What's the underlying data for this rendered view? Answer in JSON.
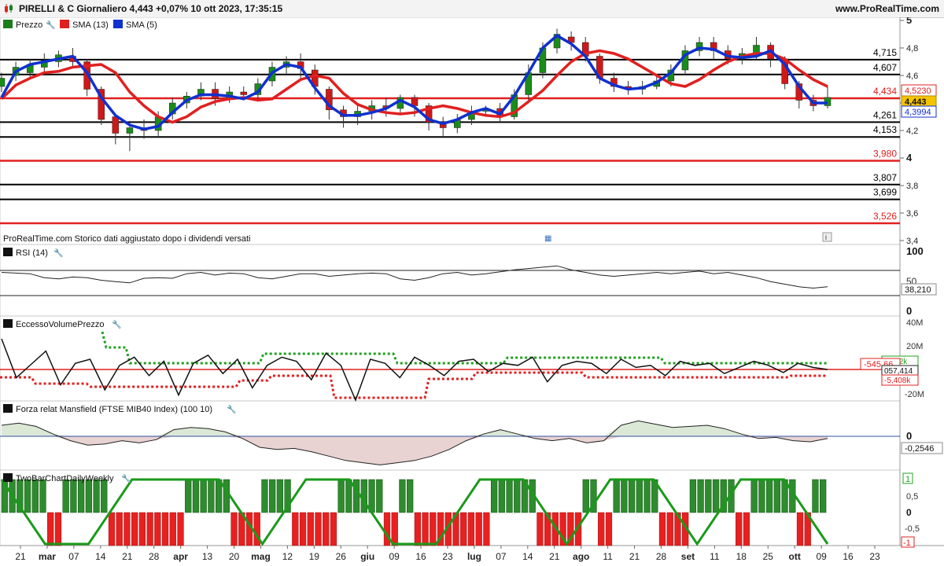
{
  "header": {
    "title": "PIRELLI & C Giornaliero 4,443 +0,07% 10 ott 2023, 17:35:15",
    "site": "www.ProRealTime.com"
  },
  "price_panel": {
    "legend": [
      "Prezzo",
      "SMA (13)",
      "SMA (5)"
    ],
    "legend_colors": [
      "#1a7f1a",
      "#e02020",
      "#1030d0"
    ],
    "footer_note": "ProRealTime.com  Storico dati aggiustato dopo i dividendi versati",
    "axis_ticks": [
      "5",
      "4,8",
      "4,6",
      "4,4",
      "4,2",
      "4",
      "3,8",
      "3,6",
      "3,4"
    ],
    "levels": [
      {
        "value": 4.715,
        "label": "4,715",
        "color": "#000000"
      },
      {
        "value": 4.607,
        "label": "4,607",
        "color": "#000000"
      },
      {
        "value": 4.434,
        "label": "4,434",
        "color": "#e02020"
      },
      {
        "value": 4.261,
        "label": "4,261",
        "color": "#000000"
      },
      {
        "value": 4.153,
        "label": "4,153",
        "color": "#000000"
      },
      {
        "value": 3.98,
        "label": "3,980",
        "color": "#e02020"
      },
      {
        "value": 3.807,
        "label": "3,807",
        "color": "#000000"
      },
      {
        "value": 3.699,
        "label": "3,699",
        "color": "#000000"
      },
      {
        "value": 3.526,
        "label": "3,526",
        "color": "#e02020"
      }
    ],
    "tags": {
      "sma13": "4,5230",
      "last": "4,443",
      "sma5": "4,3994"
    }
  },
  "rsi_panel": {
    "legend": "RSI (14)",
    "axis_ticks": [
      "100",
      "50",
      "0"
    ],
    "value_tag": "38,210"
  },
  "evp_panel": {
    "legend": "EccessoVolumePrezzo",
    "axis_ticks": [
      "40M",
      "20M",
      "-20M"
    ],
    "tags": {
      "upper": "5,112k",
      "mid": "-545,66",
      "line": "057,414",
      "lower": "-5,408k"
    }
  },
  "mansfield_panel": {
    "legend": "Forza relat Mansfield (FTSE MIB40 Index) (100 10)",
    "axis_ticks": [
      "0"
    ],
    "value_tag": "-0,2546"
  },
  "twobar_panel": {
    "legend": "TwoBarChartDailyWeekly",
    "axis_ticks": [
      "1",
      "0,5",
      "0",
      "-0,5",
      "-1"
    ],
    "tags": {
      "top": "1",
      "bottom": "-1"
    }
  },
  "x_axis": {
    "labels": [
      {
        "text": "21",
        "bold": false
      },
      {
        "text": "mar",
        "bold": true
      },
      {
        "text": "07",
        "bold": false
      },
      {
        "text": "14",
        "bold": false
      },
      {
        "text": "21",
        "bold": false
      },
      {
        "text": "28",
        "bold": false
      },
      {
        "text": "apr",
        "bold": true
      },
      {
        "text": "13",
        "bold": false
      },
      {
        "text": "20",
        "bold": false
      },
      {
        "text": "mag",
        "bold": true
      },
      {
        "text": "12",
        "bold": false
      },
      {
        "text": "19",
        "bold": false
      },
      {
        "text": "26",
        "bold": false
      },
      {
        "text": "giu",
        "bold": true
      },
      {
        "text": "09",
        "bold": false
      },
      {
        "text": "16",
        "bold": false
      },
      {
        "text": "23",
        "bold": false
      },
      {
        "text": "lug",
        "bold": true
      },
      {
        "text": "07",
        "bold": false
      },
      {
        "text": "14",
        "bold": false
      },
      {
        "text": "21",
        "bold": false
      },
      {
        "text": "ago",
        "bold": true
      },
      {
        "text": "11",
        "bold": false
      },
      {
        "text": "21",
        "bold": false
      },
      {
        "text": "28",
        "bold": false
      },
      {
        "text": "set",
        "bold": true
      },
      {
        "text": "11",
        "bold": false
      },
      {
        "text": "18",
        "bold": false
      },
      {
        "text": "25",
        "bold": false
      },
      {
        "text": "ott",
        "bold": true
      },
      {
        "text": "09",
        "bold": false
      },
      {
        "text": "16",
        "bold": false
      },
      {
        "text": "23",
        "bold": false
      }
    ]
  },
  "chart_data": {
    "type": "line",
    "title": "PIRELLI & C Giornaliero",
    "series": [
      {
        "name": "SMA (13)",
        "color": "#e02020",
        "values": [
          4.43,
          4.53,
          4.58,
          4.62,
          4.63,
          4.66,
          4.67,
          4.68,
          4.62,
          4.48,
          4.38,
          4.3,
          4.26,
          4.3,
          4.37,
          4.41,
          4.43,
          4.44,
          4.42,
          4.43,
          4.5,
          4.57,
          4.6,
          4.58,
          4.47,
          4.39,
          4.35,
          4.33,
          4.32,
          4.33,
          4.36,
          4.38,
          4.36,
          4.33,
          4.31,
          4.3,
          4.33,
          4.41,
          4.49,
          4.6,
          4.7,
          4.76,
          4.78,
          4.76,
          4.72,
          4.66,
          4.6,
          4.54,
          4.52,
          4.57,
          4.64,
          4.7,
          4.74,
          4.76,
          4.76,
          4.72,
          4.64,
          4.57,
          4.52
        ]
      },
      {
        "name": "SMA (5)",
        "color": "#1030d0",
        "values": [
          4.44,
          4.63,
          4.68,
          4.7,
          4.72,
          4.74,
          4.62,
          4.44,
          4.31,
          4.24,
          4.21,
          4.23,
          4.33,
          4.42,
          4.46,
          4.46,
          4.45,
          4.43,
          4.48,
          4.62,
          4.68,
          4.66,
          4.51,
          4.38,
          4.31,
          4.31,
          4.33,
          4.36,
          4.42,
          4.37,
          4.28,
          4.25,
          4.28,
          4.33,
          4.36,
          4.32,
          4.45,
          4.62,
          4.8,
          4.89,
          4.83,
          4.74,
          4.58,
          4.53,
          4.5,
          4.51,
          4.55,
          4.62,
          4.75,
          4.8,
          4.79,
          4.74,
          4.73,
          4.74,
          4.78,
          4.68,
          4.52,
          4.4,
          4.4
        ]
      },
      {
        "name": "RSI (14)",
        "values": [
          62,
          61,
          60,
          54,
          52,
          55,
          54,
          50,
          48,
          46,
          53,
          54,
          53,
          60,
          62,
          58,
          61,
          60,
          54,
          52,
          56,
          60,
          60,
          56,
          58,
          60,
          61,
          60,
          52,
          50,
          54,
          60,
          62,
          58,
          60,
          63,
          66,
          68,
          70,
          72,
          66,
          62,
          58,
          56,
          58,
          60,
          62,
          60,
          62,
          64,
          60,
          62,
          58,
          54,
          48,
          44,
          40,
          38,
          40
        ]
      },
      {
        "name": "Forza relat Mansfield (FTSE MIB40 Index) (100 10)",
        "values": [
          0.5,
          0.6,
          0.45,
          0.1,
          -0.2,
          -0.4,
          -0.35,
          -0.2,
          -0.3,
          -0.15,
          0.3,
          0.4,
          0.35,
          0.2,
          -0.1,
          -0.5,
          -0.6,
          -0.55,
          -0.7,
          -0.9,
          -1.1,
          -1.2,
          -1.3,
          -1.2,
          -1.1,
          -0.9,
          -0.6,
          -0.2,
          0.1,
          0.3,
          0.1,
          -0.1,
          -0.2,
          -0.1,
          -0.3,
          -0.2,
          0.5,
          0.7,
          0.55,
          0.4,
          0.45,
          0.5,
          0.35,
          0.1,
          -0.1,
          -0.05,
          -0.2,
          -0.25,
          -0.1
        ]
      },
      {
        "name": "TwoBarChartDailyWeekly",
        "values": [
          1,
          1,
          1,
          -1,
          1,
          1,
          1,
          -1,
          -1,
          -1,
          -1,
          -1,
          1,
          1,
          1,
          -1,
          -1,
          1,
          1,
          -1,
          -1,
          -1,
          1,
          1,
          1,
          -1,
          1,
          -1,
          -1,
          -1,
          -1,
          -1,
          1,
          1,
          1,
          -1,
          -1,
          -1,
          1,
          -1,
          1,
          1,
          1,
          -1,
          -1,
          1,
          1,
          1,
          -1,
          1,
          1,
          1,
          -1,
          1
        ]
      }
    ],
    "ylim": [
      3.4,
      5.0
    ],
    "rsi_ylim": [
      0,
      100
    ],
    "twobar_ylim": [
      -1,
      1
    ],
    "mansfield_ylim": [
      -1.4,
      0.8
    ],
    "candles": [
      [
        4.52,
        4.58,
        4.62,
        4.48
      ],
      [
        4.6,
        4.66,
        4.7,
        4.56
      ],
      [
        4.62,
        4.68,
        4.72,
        4.58
      ],
      [
        4.66,
        4.71,
        4.76,
        4.62
      ],
      [
        4.7,
        4.75,
        4.78,
        4.66
      ],
      [
        4.74,
        4.7,
        4.8,
        4.66
      ],
      [
        4.7,
        4.5,
        4.72,
        4.45
      ],
      [
        4.5,
        4.28,
        4.52,
        4.24
      ],
      [
        4.3,
        4.18,
        4.32,
        4.1
      ],
      [
        4.18,
        4.22,
        4.27,
        4.05
      ],
      [
        4.22,
        4.2,
        4.28,
        4.14
      ],
      [
        4.2,
        4.3,
        4.34,
        4.16
      ],
      [
        4.32,
        4.4,
        4.44,
        4.28
      ],
      [
        4.4,
        4.45,
        4.48,
        4.36
      ],
      [
        4.45,
        4.5,
        4.55,
        4.42
      ],
      [
        4.5,
        4.43,
        4.55,
        4.38
      ],
      [
        4.43,
        4.48,
        4.52,
        4.4
      ],
      [
        4.48,
        4.46,
        4.52,
        4.42
      ],
      [
        4.46,
        4.54,
        4.58,
        4.42
      ],
      [
        4.56,
        4.66,
        4.7,
        4.52
      ],
      [
        4.66,
        4.7,
        4.74,
        4.6
      ],
      [
        4.7,
        4.65,
        4.76,
        4.58
      ],
      [
        4.64,
        4.52,
        4.68,
        4.46
      ],
      [
        4.5,
        4.35,
        4.52,
        4.28
      ],
      [
        4.35,
        4.3,
        4.38,
        4.22
      ],
      [
        4.3,
        4.34,
        4.38,
        4.24
      ],
      [
        4.34,
        4.38,
        4.42,
        4.28
      ],
      [
        4.38,
        4.36,
        4.44,
        4.3
      ],
      [
        4.36,
        4.44,
        4.46,
        4.32
      ],
      [
        4.44,
        4.38,
        4.46,
        4.3
      ],
      [
        4.38,
        4.26,
        4.4,
        4.2
      ],
      [
        4.26,
        4.22,
        4.3,
        4.16
      ],
      [
        4.22,
        4.28,
        4.32,
        4.18
      ],
      [
        4.28,
        4.34,
        4.38,
        4.24
      ],
      [
        4.34,
        4.36,
        4.38,
        4.3
      ],
      [
        4.36,
        4.3,
        4.4,
        4.26
      ],
      [
        4.3,
        4.46,
        4.5,
        4.28
      ],
      [
        4.46,
        4.62,
        4.68,
        4.42
      ],
      [
        4.62,
        4.8,
        4.84,
        4.58
      ],
      [
        4.8,
        4.9,
        4.94,
        4.76
      ],
      [
        4.88,
        4.84,
        4.92,
        4.78
      ],
      [
        4.84,
        4.74,
        4.88,
        4.7
      ],
      [
        4.74,
        4.58,
        4.76,
        4.54
      ],
      [
        4.58,
        4.52,
        4.62,
        4.48
      ],
      [
        4.52,
        4.5,
        4.56,
        4.46
      ],
      [
        4.5,
        4.52,
        4.56,
        4.46
      ],
      [
        4.52,
        4.56,
        4.6,
        4.5
      ],
      [
        4.56,
        4.64,
        4.68,
        4.52
      ],
      [
        4.64,
        4.78,
        4.82,
        4.6
      ],
      [
        4.78,
        4.84,
        4.88,
        4.74
      ],
      [
        4.84,
        4.78,
        4.88,
        4.72
      ],
      [
        4.78,
        4.72,
        4.82,
        4.68
      ],
      [
        4.72,
        4.76,
        4.8,
        4.68
      ],
      [
        4.76,
        4.82,
        4.88,
        4.72
      ],
      [
        4.82,
        4.72,
        4.84,
        4.66
      ],
      [
        4.72,
        4.54,
        4.74,
        4.5
      ],
      [
        4.54,
        4.42,
        4.56,
        4.36
      ],
      [
        4.42,
        4.38,
        4.46,
        4.34
      ],
      [
        4.38,
        4.44,
        4.52,
        4.36
      ]
    ],
    "evp_line": [
      30,
      -8,
      5,
      18,
      -15,
      6,
      10,
      -20,
      4,
      12,
      -6,
      8,
      -25,
      6,
      14,
      -4,
      10,
      -18,
      4,
      12,
      8,
      -10,
      16,
      4,
      -30,
      10,
      6,
      -8,
      12,
      4,
      -6,
      8,
      10,
      -2,
      6,
      4,
      12,
      -12,
      4,
      8,
      6,
      -4,
      10,
      2,
      4,
      -6,
      8,
      4,
      6,
      -4,
      2,
      8,
      4,
      -3,
      6,
      2,
      0
    ]
  }
}
